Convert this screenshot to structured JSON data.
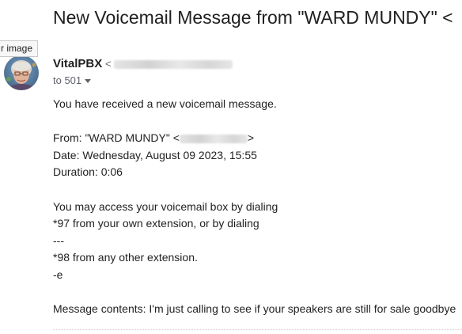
{
  "email": {
    "subject": "New Voicemail Message from \"WARD MUNDY\" <",
    "tooltip": "r image",
    "sender": {
      "name": "VitalPBX",
      "email_prefix": "<"
    },
    "recipient": "to 501",
    "body": {
      "intro": "You have received a new voicemail message.",
      "from_label": "From: \"WARD MUNDY\" <",
      "from_suffix": ">",
      "date": "Date: Wednesday, August 09 2023, 15:55",
      "duration": "Duration: 0:06",
      "access_1": "You may access your voicemail box by dialing",
      "access_2": "*97 from your own extension, or by dialing",
      "separator": "---",
      "access_3": "*98 from any other extension.",
      "signoff": "-e",
      "message_contents": "Message contents: I'm just calling to see if your speakers are still for sale goodbye"
    }
  }
}
